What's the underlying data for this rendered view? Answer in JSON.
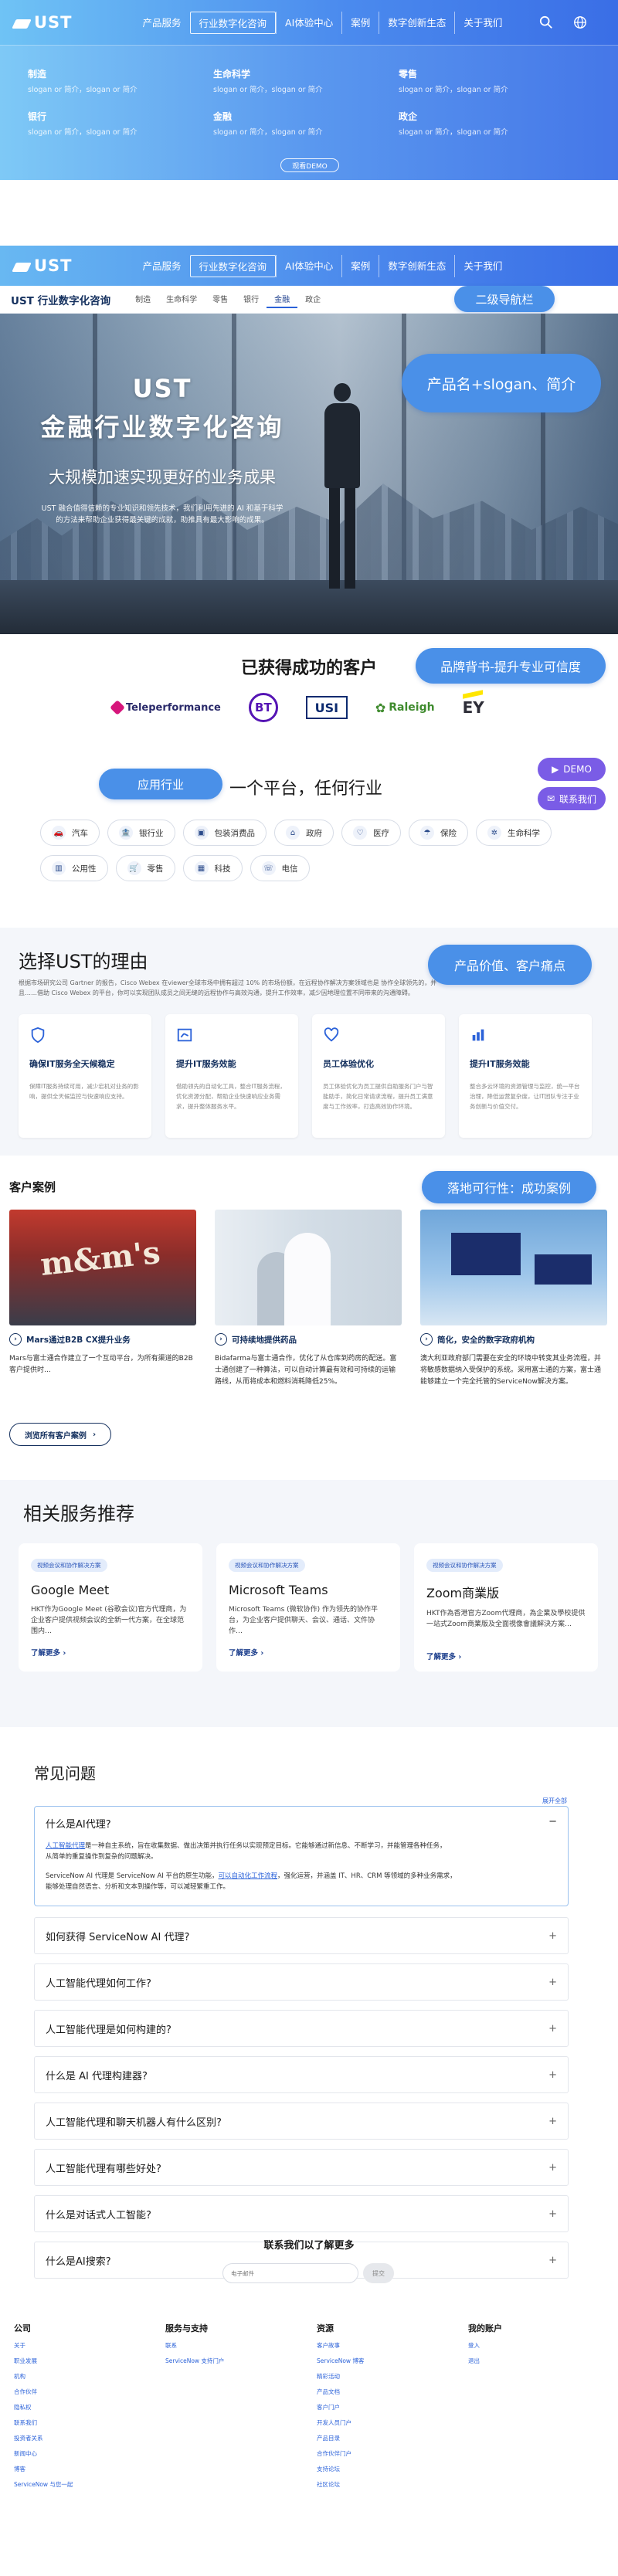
{
  "mega_preview": {
    "logo": "UST",
    "nav": [
      "产品服务",
      "行业数字化咨询",
      "AI体验中心",
      "案例",
      "数字创新生态",
      "关于我们"
    ],
    "items": [
      {
        "title": "制造",
        "slogan": "slogan or 简介，slogan or 简介"
      },
      {
        "title": "生命科学",
        "slogan": "slogan or 简介，slogan or 简介"
      },
      {
        "title": "零售",
        "slogan": "slogan or 简介，slogan or 简介"
      },
      {
        "title": "银行",
        "slogan": "slogan or 简介，slogan or 简介"
      },
      {
        "title": "金融",
        "slogan": "slogan or 简介，slogan or 简介"
      },
      {
        "title": "政企",
        "slogan": "slogan or 简介，slogan or 简介"
      }
    ],
    "demo_button": "观看DEMO"
  },
  "site_nav": {
    "logo": "UST",
    "nav": [
      "产品服务",
      "行业数字化咨询",
      "AI体验中心",
      "案例",
      "数字创新生态",
      "关于我们"
    ]
  },
  "subnav": {
    "title": "UST 行业数字化咨询",
    "items": [
      "制造",
      "生命科学",
      "零售",
      "银行",
      "金融",
      "政企"
    ],
    "annotation": "二级导航栏"
  },
  "hero": {
    "line1": "UST",
    "line2": "金融行业数字化咨询",
    "subtitle": "大规模加速实现更好的业务成果",
    "body": "UST 融合值得信赖的专业知识和领先技术，我们利用先进的 AI 和基于科学的方法来帮助企业获得最关键的成就，助推具有最大影响的成果。",
    "annotation": "产品名+slogan、简介"
  },
  "clients": {
    "title": "已获得成功的客户",
    "annotation": "品牌背书-提升专业可信度",
    "logos": [
      "Teleperformance",
      "BT",
      "USI",
      "Raleigh",
      "EY"
    ]
  },
  "industry": {
    "annotation": "应用行业",
    "title": "一个平台，任何行业",
    "demo_label": "DEMO",
    "sales_label": "联系我们",
    "pills": [
      {
        "label": "汽车",
        "icon": "car-icon"
      },
      {
        "label": "银行业",
        "icon": "bank-icon"
      },
      {
        "label": "包装消费品",
        "icon": "package-icon"
      },
      {
        "label": "政府",
        "icon": "government-icon"
      },
      {
        "label": "医疗",
        "icon": "health-icon"
      },
      {
        "label": "保险",
        "icon": "insurance-icon"
      },
      {
        "label": "生命科学",
        "icon": "dna-icon"
      },
      {
        "label": "公用性",
        "icon": "utility-icon"
      },
      {
        "label": "零售",
        "icon": "cart-icon"
      },
      {
        "label": "科技",
        "icon": "chip-icon"
      },
      {
        "label": "电信",
        "icon": "telecom-icon"
      }
    ]
  },
  "why": {
    "title": "选择UST的理由",
    "annotation": "产品价值、客户痛点",
    "desc": "根据市场研究公司 Gartner 的报告，Cisco Webex 在viewer全球市场中拥有超过 10% 的市场份额，在远程协作解决方案领域也是 协作全球领先的，并且……借助 Cisco Webex 的平台，你可以实现团队成员之间无缝的远程协作与高效沟通，提升工作效率，减少因地理位置不同带来的沟通障碍。",
    "cards": [
      {
        "title": "确保IT服务全天候稳定",
        "desc": "保障IT服务持续可用，减少宕机对业务的影响，提供全天候监控与快速响应支持。",
        "icon": "shield-icon"
      },
      {
        "title": "提升IT服务效能",
        "desc": "借助领先的自动化工具，整合IT服务流程，优化资源分配，帮助企业快速响应业务需求，提升整体服务水平。",
        "icon": "gauge-icon"
      },
      {
        "title": "员工体验优化",
        "desc": "员工体验优化为员工提供自助服务门户与智能助手，简化日常请求流程，提升员工满意度与工作效率，打造高效协作环境。",
        "icon": "heart-icon"
      },
      {
        "title": "提升IT服务效能",
        "desc": "整合多云环境的资源管理与监控，统一平台治理，降低运营复杂度，让IT团队专注于业务创新与价值交付。",
        "icon": "chart-icon"
      }
    ]
  },
  "cases": {
    "title": "客户案例",
    "annotation": "落地可行性：成功案例",
    "items": [
      {
        "title": "Mars通过B2B CX提升业务",
        "desc": "Mars与富士通合作建立了一个互动平台，为所有渠道的B2B客户提供时…"
      },
      {
        "title": "可持续地提供药品",
        "desc": "Bidafarma与富士通合作，优化了从仓库到药房的配送。富士通创建了一种算法，可以自动计算最有效和可持续的运输路线，从而将成本和燃料消耗降低25%。"
      },
      {
        "title": "简化，安全的数字政府机构",
        "desc": "澳大利亚政府部门需要在安全的环境中转变其业务流程，并将敏感数据纳入受保护的系统。采用富士通的方案，富士通能够建立一个完全托管的ServiceNow解决方案。"
      }
    ],
    "browse_label": "浏览所有客户案例"
  },
  "services": {
    "title": "相关服务推荐",
    "items": [
      {
        "tag": "视频会议和协作解决方案",
        "title": "Google Meet",
        "desc": "HKT作为Google Meet (谷歌会议)官方代理商，为企业客户提供视频会议的全新一代方案，在全球范围内…",
        "more": "了解更多"
      },
      {
        "tag": "视频会议和协作解决方案",
        "title": "Microsoft Teams",
        "desc": "Microsoft Teams (微软协作) 作为领先的协作平台，为企业客户提供聊天、会议、通话、文件协作…",
        "more": "了解更多"
      },
      {
        "tag": "视频会议和协作解决方案",
        "title": "Zoom商業版",
        "desc": "HKT作為香港官方Zoom代理商，為企業及學校提供一站式Zoom商業版及全面視像會議解決方案…",
        "more": "了解更多"
      }
    ]
  },
  "faq": {
    "title": "常见问题",
    "expand_all": "展开全部",
    "open": {
      "question": "什么是AI代理?",
      "answer1_link": "人工智能代理",
      "answer1": "是一种自主系统，旨在收集数据、做出决策并执行任务以实现预定目标。它能够通过新信息、不断学习，并能管理各种任务，从简单的重复操作到复杂的问题解决。",
      "answer2": "ServiceNow AI 代理是 ServiceNow AI 平台的原生功能，",
      "answer2_link": "可以自动化工作流程",
      "answer2_tail": "，强化运营，并涵盖 IT、HR、CRM 等领域的多种业务需求，能够处理自然语言、分析和文本到操作等，可以减轻繁重工作。"
    },
    "items": [
      "如何获得 ServiceNow AI 代理?",
      "人工智能代理如何工作?",
      "人工智能代理是如何构建的?",
      "什么是 AI 代理构建器?",
      "人工智能代理和聊天机器人有什么区别?",
      "人工智能代理有哪些好处?",
      "什么是对话式人工智能?",
      "什么是AI搜索?"
    ]
  },
  "contact": {
    "title": "联系我们以了解更多",
    "placeholder": "电子邮件",
    "button": "提交"
  },
  "footer": {
    "columns": [
      {
        "title": "公司",
        "links": [
          "关于",
          "职业发展",
          "机构",
          "合作伙伴",
          "隐私权",
          "联系我们",
          "投资者关系",
          "新闻中心",
          "博客",
          "ServiceNow 与您一起"
        ]
      },
      {
        "title": "服务与支持",
        "links": [
          "联系",
          "ServiceNow 支持门户"
        ]
      },
      {
        "title": "资源",
        "links": [
          "客户故事",
          "ServiceNow 博客",
          "精彩活动",
          "产品文档",
          "客户门户",
          "开发人员门户",
          "产品目录",
          "合作伙伴门户",
          "支持论坛",
          "社区论坛"
        ]
      },
      {
        "title": "我的账户",
        "links": [
          "登入",
          "退出"
        ]
      }
    ]
  }
}
